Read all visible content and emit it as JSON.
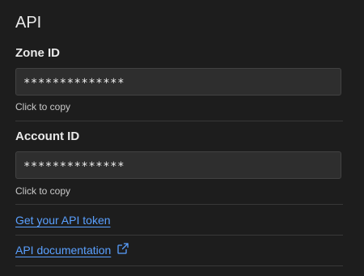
{
  "section": {
    "title": "API"
  },
  "zone": {
    "label": "Zone ID",
    "value": "**************",
    "hint": "Click to copy"
  },
  "account": {
    "label": "Account ID",
    "value": "**************",
    "hint": "Click to copy"
  },
  "links": {
    "api_token": "Get your API token",
    "api_docs": "API documentation"
  },
  "icons": {
    "external": "external-link-icon"
  },
  "colors": {
    "background": "#1d1d1d",
    "field_background": "#2e2e2e",
    "link": "#5aa0ff",
    "divider": "#383838"
  }
}
